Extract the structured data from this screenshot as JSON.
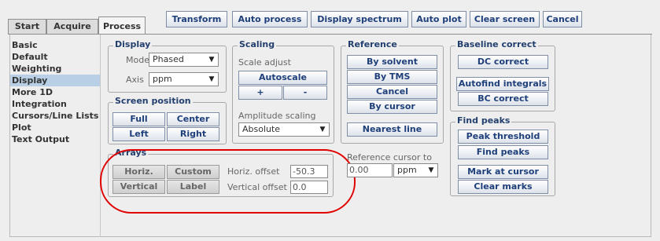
{
  "tabs": [
    {
      "label": "Start"
    },
    {
      "label": "Acquire"
    },
    {
      "label": "Process",
      "active": true
    }
  ],
  "toolbar": {
    "transform": "Transform",
    "auto_process": "Auto process",
    "display_spectrum": "Display spectrum",
    "auto_plot": "Auto plot",
    "clear_screen": "Clear screen",
    "cancel": "Cancel"
  },
  "sidebar": {
    "items": [
      {
        "label": "Basic"
      },
      {
        "label": "Default"
      },
      {
        "label": "Weighting"
      },
      {
        "label": "Display",
        "selected": true
      },
      {
        "label": "More 1D"
      },
      {
        "label": "Integration"
      },
      {
        "label": "Cursors/Line Lists"
      },
      {
        "label": "Plot"
      },
      {
        "label": "Text Output"
      }
    ]
  },
  "display": {
    "title": "Display",
    "mode_label": "Mode",
    "mode_value": "Phased",
    "axis_label": "Axis",
    "axis_value": "ppm"
  },
  "screen_position": {
    "title": "Screen position",
    "full": "Full",
    "center": "Center",
    "left": "Left",
    "right": "Right"
  },
  "scaling": {
    "title": "Scaling",
    "scale_adjust": "Scale adjust",
    "autoscale": "Autoscale",
    "plus": "+",
    "minus": "-",
    "amplitude_label": "Amplitude scaling",
    "amplitude_value": "Absolute"
  },
  "arrays": {
    "title": "Arrays",
    "horiz": "Horiz.",
    "custom": "Custom",
    "vertical": "Vertical",
    "label": "Label",
    "horiz_offset_label": "Horiz. offset",
    "horiz_offset_value": "-50.3",
    "vertical_offset_label": "Vertical offset",
    "vertical_offset_value": "0.0"
  },
  "reference": {
    "title": "Reference",
    "by_solvent": "By solvent",
    "by_tms": "By TMS",
    "cancel": "Cancel",
    "by_cursor": "By cursor",
    "nearest_line": "Nearest line",
    "ref_cursor_label": "Reference cursor to",
    "ref_cursor_value": "0.00",
    "ref_unit": "ppm"
  },
  "baseline": {
    "title": "Baseline correct",
    "dc_correct": "DC correct",
    "autofind_integrals": "Autofind integrals",
    "bc_correct": "BC correct"
  },
  "find_peaks": {
    "title": "Find peaks",
    "peak_threshold": "Peak threshold",
    "find_peaks": "Find peaks",
    "mark_at_cursor": "Mark at cursor",
    "clear_marks": "Clear marks"
  },
  "icons": {
    "dropdown": "chevron-down-icon"
  },
  "colors": {
    "annotation": "#e00000",
    "selected": "#b8cfe5",
    "button_text": "#1e3f7a"
  }
}
